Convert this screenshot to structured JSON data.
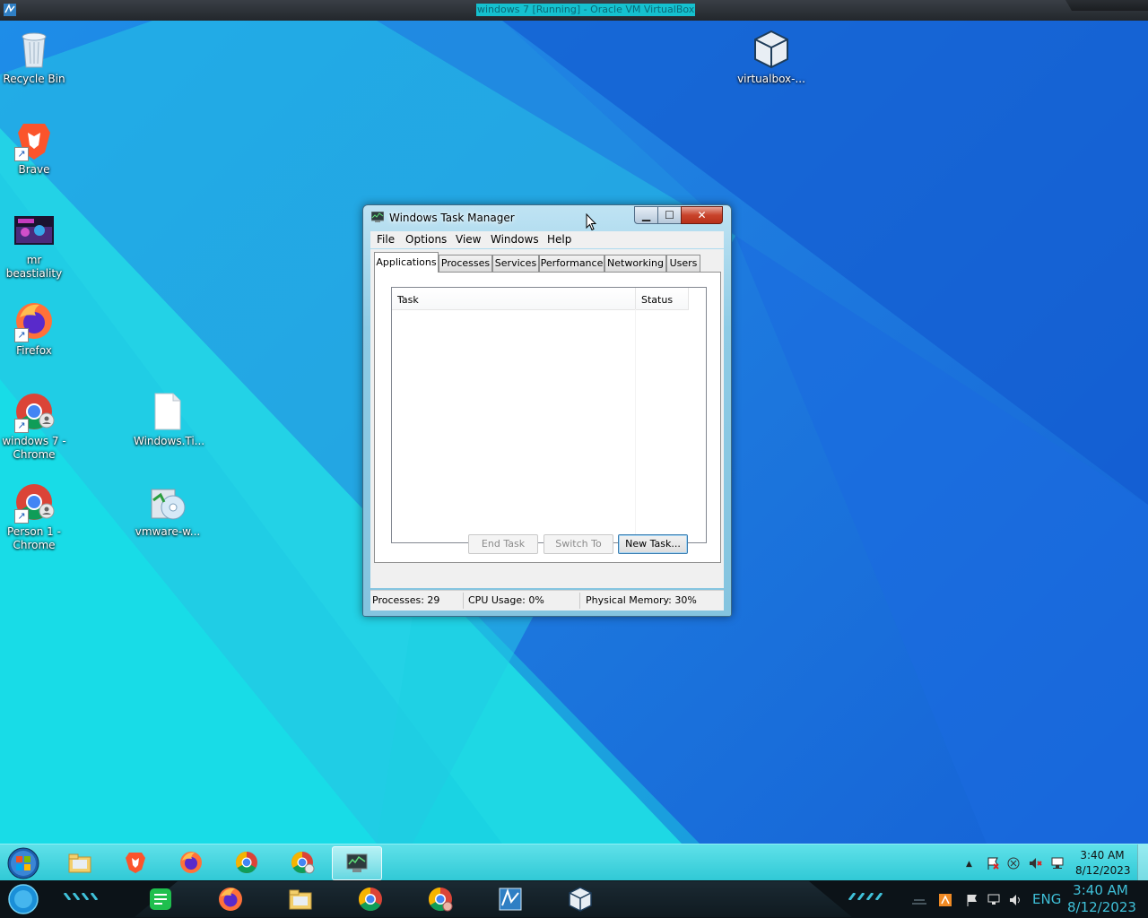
{
  "host_window": {
    "title": "windows 7 [Running] - Oracle VM VirtualBox"
  },
  "desktop": {
    "icons": [
      {
        "label": "Recycle Bin",
        "icon": "recycle-bin-icon"
      },
      {
        "label": "Brave",
        "icon": "brave-icon"
      },
      {
        "label": "mr beastiality",
        "icon": "image-thumbnail-icon"
      },
      {
        "label": "Firefox",
        "icon": "firefox-icon"
      },
      {
        "label": "windows 7 - Chrome",
        "icon": "chrome-profile-icon"
      },
      {
        "label": "Windows.Ti...",
        "icon": "blank-file-icon"
      },
      {
        "label": "Person 1 - Chrome",
        "icon": "chrome-profile-icon"
      },
      {
        "label": "vmware-w...",
        "icon": "installer-disc-icon"
      },
      {
        "label": "virtualbox-...",
        "icon": "virtualbox-cube-icon"
      }
    ]
  },
  "task_manager": {
    "title": "Windows Task Manager",
    "menu": [
      "File",
      "Options",
      "View",
      "Windows",
      "Help"
    ],
    "tabs": [
      "Applications",
      "Processes",
      "Services",
      "Performance",
      "Networking",
      "Users"
    ],
    "active_tab": "Applications",
    "columns": {
      "task": "Task",
      "status": "Status"
    },
    "buttons": {
      "end_task": "End Task",
      "switch_to": "Switch To",
      "new_task": "New Task..."
    },
    "status": {
      "processes": "Processes: 29",
      "cpu": "CPU Usage: 0%",
      "memory": "Physical Memory: 30%"
    }
  },
  "guest_taskbar": {
    "pinned": [
      "windows-explorer-icon",
      "brave-icon",
      "firefox-icon",
      "chrome-icon",
      "chrome-profile-icon",
      "task-manager-icon"
    ],
    "clock": {
      "time": "3:40 AM",
      "date": "8/12/2023"
    }
  },
  "host_taskbar": {
    "apps": [
      "notes-app-icon",
      "firefox-icon",
      "file-explorer-icon",
      "chrome-icon",
      "chrome-profile-icon",
      "windows7-vm-icon",
      "virtualbox-icon"
    ],
    "language": "ENG",
    "clock": {
      "time": "3:40 AM",
      "date": "8/12/2023"
    }
  },
  "colors": {
    "desktop_cyan": "#1fd3e0",
    "desktop_blue": "#1565d8",
    "host_accent": "#3fc0d8"
  }
}
